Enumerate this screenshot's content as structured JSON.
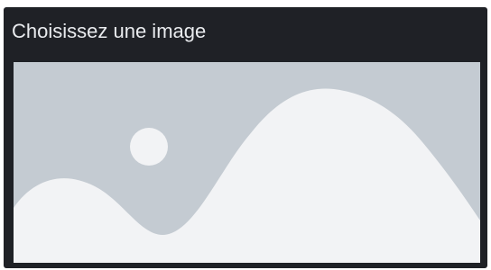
{
  "panel": {
    "title": "Choisissez une image"
  },
  "picker": {
    "icon": "image-placeholder-icon",
    "colors": {
      "background": "#1f2126",
      "placeholder_bg": "#c4cbd2",
      "placeholder_fg": "#f2f3f5"
    }
  }
}
